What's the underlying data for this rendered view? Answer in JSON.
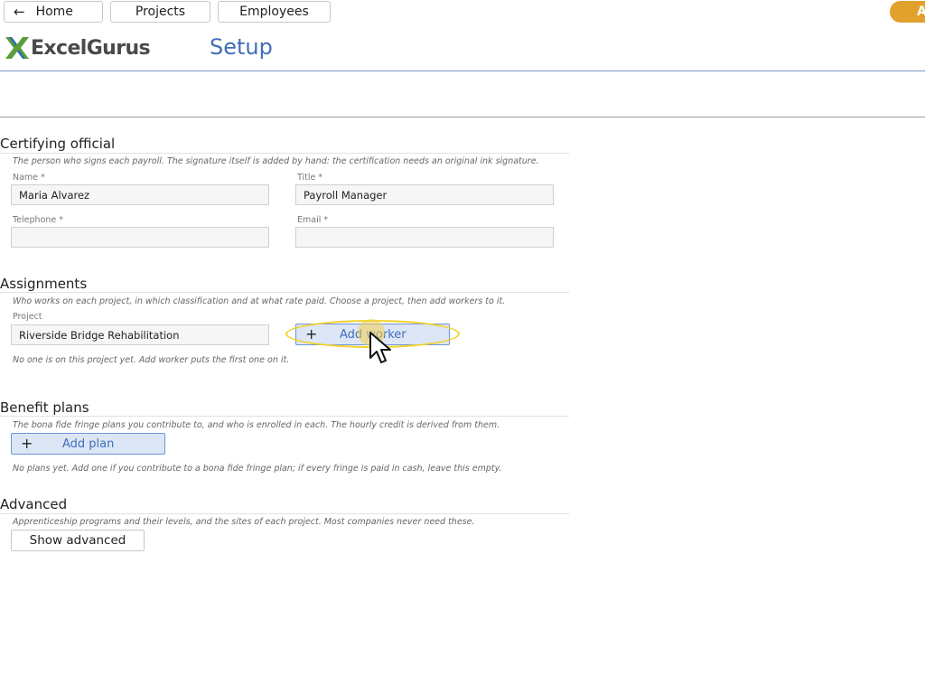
{
  "nav": {
    "home_label": "Home",
    "projects_label": "Projects",
    "employees_label": "Employees",
    "user_initial": "A"
  },
  "brand": {
    "name": "ExcelGurus",
    "accent": "#3f6fb7",
    "logo_green": "#5a9e3c",
    "logo_blue": "#2f6db5"
  },
  "page_title": "Setup",
  "certifying": {
    "title": "Certifying official",
    "description": "The person who signs each payroll. The signature itself is added by hand: the certification needs an original ink signature.",
    "name_label": "Name *",
    "name_value": "Maria Alvarez",
    "title_label": "Title *",
    "title_value": "Payroll Manager",
    "telephone_label": "Telephone *",
    "telephone_value": "",
    "email_label": "Email *",
    "email_value": ""
  },
  "assignments": {
    "title": "Assignments",
    "description": "Who works on each project, in which classification and at what rate paid. Choose a project, then add workers to it.",
    "project_label": "Project",
    "project_value": "Riverside Bridge Rehabilitation",
    "add_worker_label": "Add worker",
    "empty_hint": "No one is on this project yet. Add worker puts the first one on it."
  },
  "benefits": {
    "title": "Benefit plans",
    "description": "The bona fide fringe plans you contribute to, and who is enrolled in each. The hourly credit is derived from them.",
    "add_plan_label": "Add plan",
    "empty_hint": "No plans yet. Add one if you contribute to a bona fide fringe plan; if every fringe is paid in cash, leave this empty."
  },
  "advanced": {
    "title": "Advanced",
    "description": "Apprenticeship programs and their levels, and the sites of each project. Most companies never need these.",
    "show_label": "Show advanced"
  }
}
